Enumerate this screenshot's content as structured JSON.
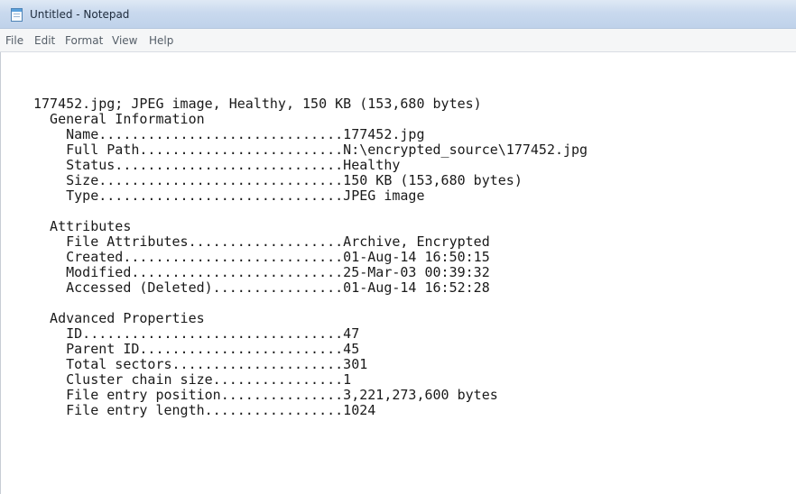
{
  "window": {
    "title": "Untitled - Notepad",
    "icon": "notepad-icon"
  },
  "menu": [
    {
      "label": "File"
    },
    {
      "label": "Edit"
    },
    {
      "label": "Format"
    },
    {
      "label": "View"
    },
    {
      "label": "Help"
    }
  ],
  "document": {
    "lines": [
      "177452.jpg; JPEG image, Healthy, 150 KB (153,680 bytes)",
      "  General Information",
      "    Name..............................177452.jpg",
      "    Full Path.........................N:\\encrypted_source\\177452.jpg",
      "    Status............................Healthy",
      "    Size..............................150 KB (153,680 bytes)",
      "    Type..............................JPEG image",
      "",
      "  Attributes",
      "    File Attributes...................Archive, Encrypted",
      "    Created...........................01-Aug-14 16:50:15",
      "    Modified..........................25-Mar-03 00:39:32",
      "    Accessed (Deleted)................01-Aug-14 16:52:28",
      "",
      "  Advanced Properties",
      "    ID................................47",
      "    Parent ID.........................45",
      "    Total sectors.....................301",
      "    Cluster chain size................1",
      "    File entry position...............3,221,273,600 bytes",
      "    File entry length.................1024"
    ]
  }
}
